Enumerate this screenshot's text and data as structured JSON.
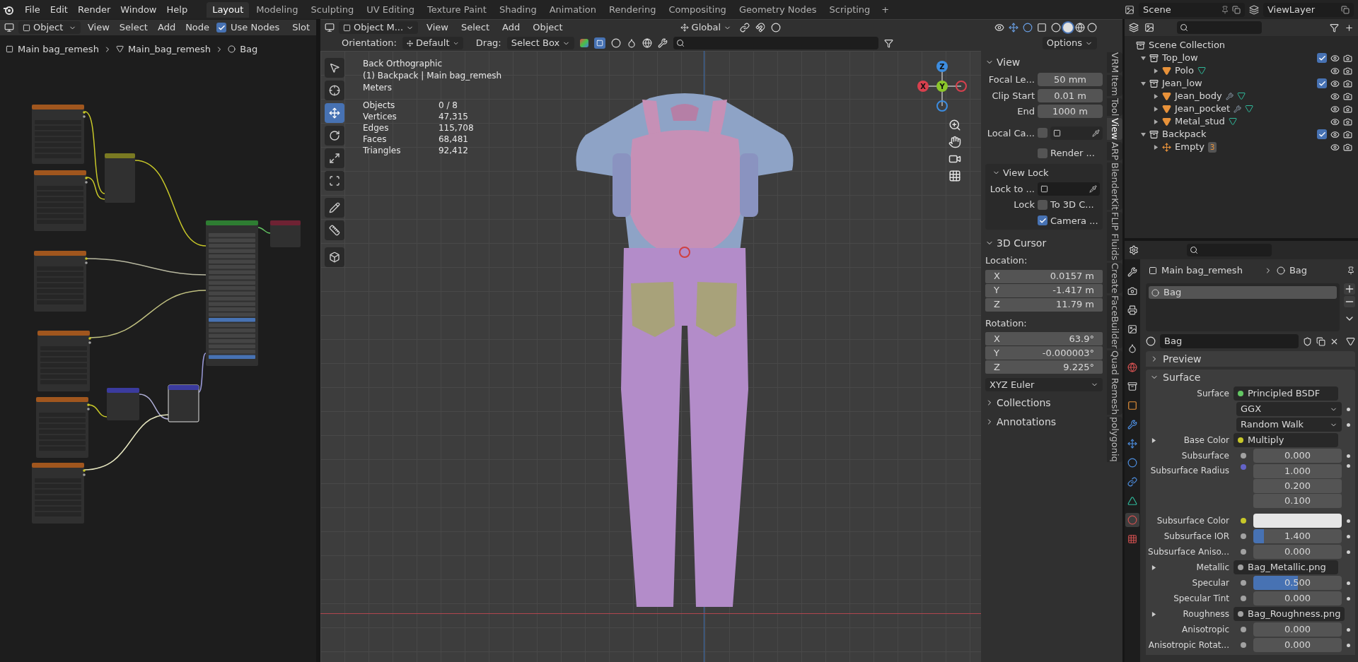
{
  "top_bar": {
    "menus": [
      "File",
      "Edit",
      "Render",
      "Window",
      "Help"
    ],
    "workspaces": [
      {
        "label": "Layout",
        "selected": true
      },
      {
        "label": "Modeling",
        "selected": false
      },
      {
        "label": "Sculpting",
        "selected": false
      },
      {
        "label": "UV Editing",
        "selected": false
      },
      {
        "label": "Texture Paint",
        "selected": false
      },
      {
        "label": "Shading",
        "selected": false
      },
      {
        "label": "Animation",
        "selected": false
      },
      {
        "label": "Rendering",
        "selected": false
      },
      {
        "label": "Compositing",
        "selected": false
      },
      {
        "label": "Geometry Nodes",
        "selected": false
      },
      {
        "label": "Scripting",
        "selected": false
      }
    ],
    "add_tab": "+",
    "scene": "Scene",
    "view_layer": "ViewLayer"
  },
  "node_editor": {
    "mode": "Object",
    "menus": [
      "View",
      "Select",
      "Add",
      "Node"
    ],
    "use_nodes": {
      "label": "Use Nodes",
      "checked": true
    },
    "slot": "Slot",
    "breadcrumb": [
      "Main bag_remesh",
      "Main_bag_remesh",
      "Bag"
    ]
  },
  "viewport": {
    "mode": "Object M...",
    "menus": [
      "View",
      "Select",
      "Add",
      "Object"
    ],
    "transform": "Global",
    "orientation_label": "Orientation:",
    "orientation": "Default",
    "drag_label": "Drag:",
    "drag": "Select Box",
    "options": "Options",
    "overlay_text": [
      "Back Orthographic",
      "(1) Backpack | Main bag_remesh",
      "Meters"
    ],
    "stats": [
      {
        "label": "Objects",
        "value": "0 / 8"
      },
      {
        "label": "Vertices",
        "value": "47,315"
      },
      {
        "label": "Edges",
        "value": "115,708"
      },
      {
        "label": "Faces",
        "value": "68,481"
      },
      {
        "label": "Triangles",
        "value": "92,412"
      }
    ],
    "tools": [
      {
        "selected": false
      },
      {
        "selected": false
      },
      {
        "selected": true
      },
      {
        "selected": false
      },
      {
        "selected": false
      },
      {
        "selected": false
      },
      {
        "selected": false
      },
      {
        "selected": false
      },
      {
        "selected": false
      }
    ],
    "gizmo_axes": [
      "X",
      "Y",
      "Z"
    ]
  },
  "sidebar": {
    "tabs": [
      {
        "label": "VRM",
        "selected": false
      },
      {
        "label": "Item",
        "selected": false
      },
      {
        "label": "Tool",
        "selected": false
      },
      {
        "label": "View",
        "selected": true
      },
      {
        "label": "ARP",
        "selected": false
      },
      {
        "label": "BlenderKit",
        "selected": false
      },
      {
        "label": "FLIP Fluids",
        "selected": false
      },
      {
        "label": "Create",
        "selected": false
      },
      {
        "label": "FaceBuilder",
        "selected": false
      },
      {
        "label": "Quad Remesh",
        "selected": false
      },
      {
        "label": "polygoniq",
        "selected": false
      }
    ],
    "view": {
      "title": "View",
      "fields": [
        {
          "label": "Focal Le...",
          "value": "50 mm"
        },
        {
          "label": "Clip Start",
          "value": "0.01 m"
        },
        {
          "label": "End",
          "value": "1000 m"
        }
      ],
      "local_camera": {
        "label": "Local Ca...",
        "checked": false
      },
      "render": {
        "label": "Render ...",
        "checked": false
      },
      "view_lock": {
        "title": "View Lock",
        "lock_to": "Lock to ...",
        "lock": "Lock",
        "options": [
          {
            "label": "To 3D C...",
            "checked": false
          },
          {
            "label": "Camera ...",
            "checked": true
          }
        ]
      }
    },
    "cursor": {
      "title": "3D Cursor",
      "location_label": "Location:",
      "location": [
        {
          "axis": "X",
          "value": "0.0157 m"
        },
        {
          "axis": "Y",
          "value": "-1.417 m"
        },
        {
          "axis": "Z",
          "value": "11.79 m"
        }
      ],
      "rotation_label": "Rotation:",
      "rotation": [
        {
          "axis": "X",
          "value": "63.9°"
        },
        {
          "axis": "Y",
          "value": "-0.000003°"
        },
        {
          "axis": "Z",
          "value": "9.225°"
        }
      ],
      "mode": "XYZ Euler"
    },
    "collapsed_panels": [
      "Collections",
      "Annotations"
    ]
  },
  "outliner": {
    "root": "Scene Collection",
    "items": [
      {
        "name": "Top_low",
        "kind": "collection",
        "expanded": true,
        "checked": true,
        "children": [
          {
            "name": "Polo",
            "kind": "mesh",
            "expanded": false,
            "modifiers": false
          }
        ]
      },
      {
        "name": "Jean_low",
        "kind": "collection",
        "expanded": true,
        "checked": true,
        "children": [
          {
            "name": "Jean_body",
            "kind": "mesh",
            "expanded": false,
            "modifiers": true
          },
          {
            "name": "Jean_pocket",
            "kind": "mesh",
            "expanded": false,
            "modifiers": true
          },
          {
            "name": "Metal_stud",
            "kind": "mesh",
            "expanded": false,
            "modifiers": false
          }
        ]
      },
      {
        "name": "Backpack",
        "kind": "collection",
        "expanded": true,
        "checked": true,
        "children": [
          {
            "name": "Empty",
            "kind": "empty",
            "expanded": false,
            "badge": "3"
          }
        ]
      }
    ]
  },
  "properties": {
    "tabs": [
      {
        "selected": false
      },
      {
        "selected": false
      },
      {
        "selected": false
      },
      {
        "selected": false
      },
      {
        "selected": false
      },
      {
        "selected": false
      },
      {
        "selected": false
      },
      {
        "selected": false
      },
      {
        "selected": false
      },
      {
        "selected": false
      },
      {
        "selected": false
      },
      {
        "selected": false
      },
      {
        "selected": false
      },
      {
        "selected": true
      },
      {
        "selected": false
      }
    ],
    "breadcrumb": [
      "Main bag_remesh",
      "Bag"
    ],
    "slots": [
      {
        "name": "Bag",
        "selected": true
      }
    ],
    "material": "Bag",
    "panels": [
      {
        "title": "Preview",
        "expanded": false
      },
      {
        "title": "Surface",
        "expanded": true
      }
    ],
    "rows": [
      {
        "kind": "link",
        "label": "Surface",
        "value": "Principled BSDF",
        "color": "#63c763",
        "expandable": false
      },
      {
        "kind": "enum",
        "value": "GGX"
      },
      {
        "kind": "enum",
        "value": "Random Walk"
      },
      {
        "kind": "link",
        "label": "Base Color",
        "value": "Multiply",
        "color": "#c7c729",
        "expandable": true
      },
      {
        "kind": "field",
        "label": "Subsurface",
        "value": "0.000",
        "color": "#a1a1a1"
      },
      {
        "kind": "vector",
        "label": "Subsurface Radius",
        "values": [
          "1.000",
          "0.200",
          "0.100"
        ],
        "color": "#6363c7"
      },
      {
        "kind": "swatch",
        "label": "Subsurface Color",
        "color": "#c7c729"
      },
      {
        "kind": "number",
        "label": "Subsurface IOR",
        "value": "1.400",
        "color": "#a1a1a1",
        "level": 0.12
      },
      {
        "kind": "field",
        "label": "Subsurface Aniso...",
        "value": "0.000",
        "color": "#a1a1a1"
      },
      {
        "kind": "link",
        "label": "Metallic",
        "value": "Bag_Metallic.png",
        "color": "#a1a1a1",
        "expandable": true
      },
      {
        "kind": "number",
        "label": "Specular",
        "value": "0.500",
        "color": "#a1a1a1",
        "level": 0.5
      },
      {
        "kind": "field",
        "label": "Specular Tint",
        "value": "0.000",
        "color": "#a1a1a1"
      },
      {
        "kind": "link",
        "label": "Roughness",
        "value": "Bag_Roughness.png",
        "color": "#a1a1a1",
        "expandable": true
      },
      {
        "kind": "field",
        "label": "Anisotropic",
        "value": "0.000",
        "color": "#a1a1a1"
      },
      {
        "kind": "field",
        "label": "Anisotropic Rotat...",
        "value": "0.000",
        "color": "#a1a1a1"
      }
    ]
  }
}
